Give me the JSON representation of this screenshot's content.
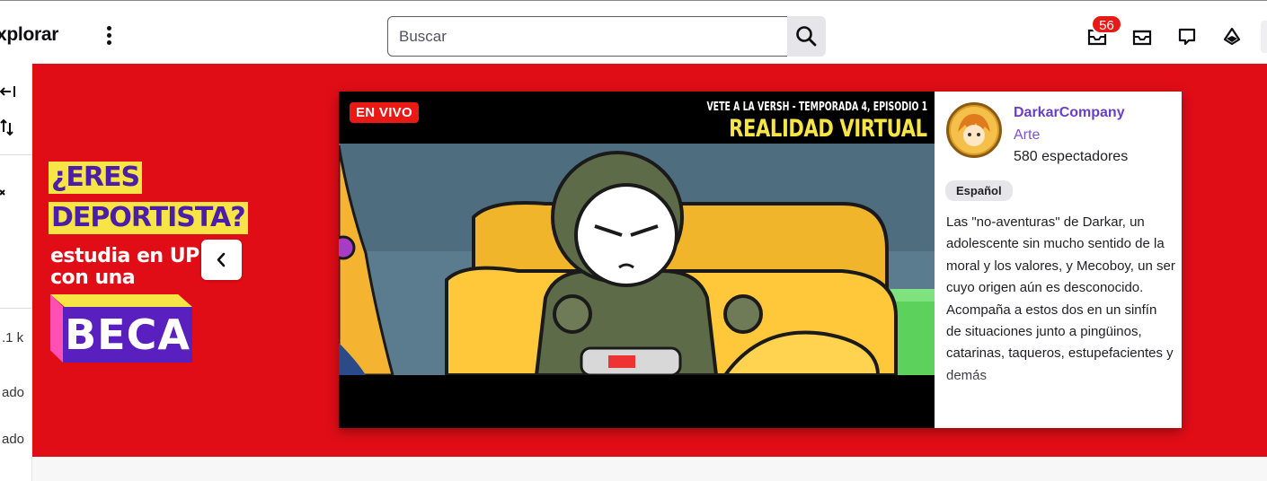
{
  "topbar": {
    "explore_label": "xplorar",
    "search_placeholder": "Buscar",
    "notifications_count": "56"
  },
  "sidebar": {
    "viewers_fragment": ".1 k",
    "item_a": "ado",
    "item_b": "ado"
  },
  "ad": {
    "line1": "¿ERES",
    "line2": "DEPORTISTA?",
    "line3": "estudia en UP",
    "line4": "con una",
    "beca": "BECA"
  },
  "stream": {
    "live_badge": "EN VIVO",
    "episode_title": "VETE A LA VERSH - TEMPORADA 4, EPISODIO 1",
    "episode_subtitle": "REALIDAD VIRTUAL",
    "channel_name": "DarkarCompany",
    "category": "Arte",
    "viewers": "580 espectadores",
    "tag": "Español",
    "description": "Las \"no-aventuras\" de Darkar, un adolescente sin mucho sentido de la moral y los valores, y Mecoboy, un ser cuyo origen aún es desconocido. Acompaña a estos dos en un sinfín de situaciones junto a pingüinos, catarinas, taqueros, estupefacientes y demás"
  },
  "colors": {
    "hero_bg": "#e00d17",
    "accent_purple": "#6a3fc6",
    "live_red": "#e91916",
    "ad_yellow": "#f7e545"
  }
}
